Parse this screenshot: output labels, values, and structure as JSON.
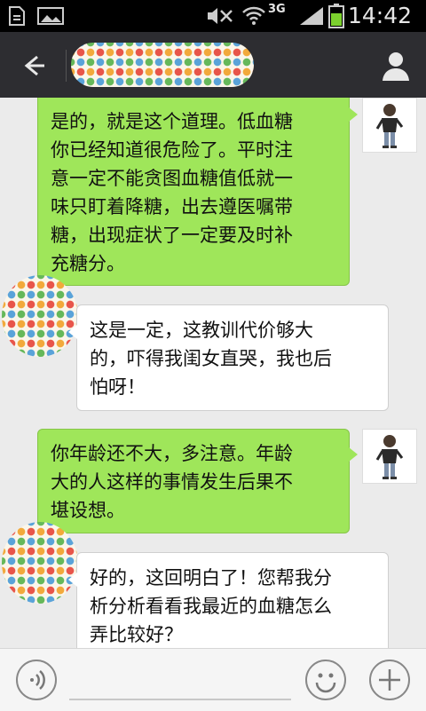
{
  "status_bar": {
    "time": "14:42",
    "network": "3G",
    "icons": [
      "document-icon",
      "image-icon",
      "mute-icon",
      "wifi-icon",
      "signal-icon",
      "battery-icon"
    ]
  },
  "header": {
    "back_icon": "arrow-left-icon",
    "profile_icon": "person-icon"
  },
  "messages": [
    {
      "sender": "me",
      "lines": [
        "是的，就是这个道理。低血糖",
        "你已经知道很危险了。平时注",
        "意一定不能贪图血糖值低就一",
        "味只盯着降糖，出去遵医嘱带",
        "糖，出现症状了一定要及时补",
        "充糖分。"
      ]
    },
    {
      "sender": "them",
      "lines": [
        "这是一定，这教训代价够大",
        "的，吓得我闺女直哭，我也后",
        "怕呀！"
      ]
    },
    {
      "sender": "me",
      "lines": [
        "你年龄还不大，多注意。年龄",
        "大的人这样的事情发生后果不",
        "堪设想。"
      ]
    },
    {
      "sender": "them",
      "lines": [
        "好的，这回明白了！您帮我分",
        "析分析看看我最近的血糖怎么",
        "弄比较好？"
      ]
    }
  ],
  "input_bar": {
    "voice_icon": "voice-icon",
    "emoji_icon": "smiley-icon",
    "plus_icon": "plus-icon"
  },
  "colors": {
    "my_bubble": "#9fe65a",
    "their_bubble": "#ffffff",
    "header": "#2d2d31",
    "background": "#ebebeb"
  }
}
